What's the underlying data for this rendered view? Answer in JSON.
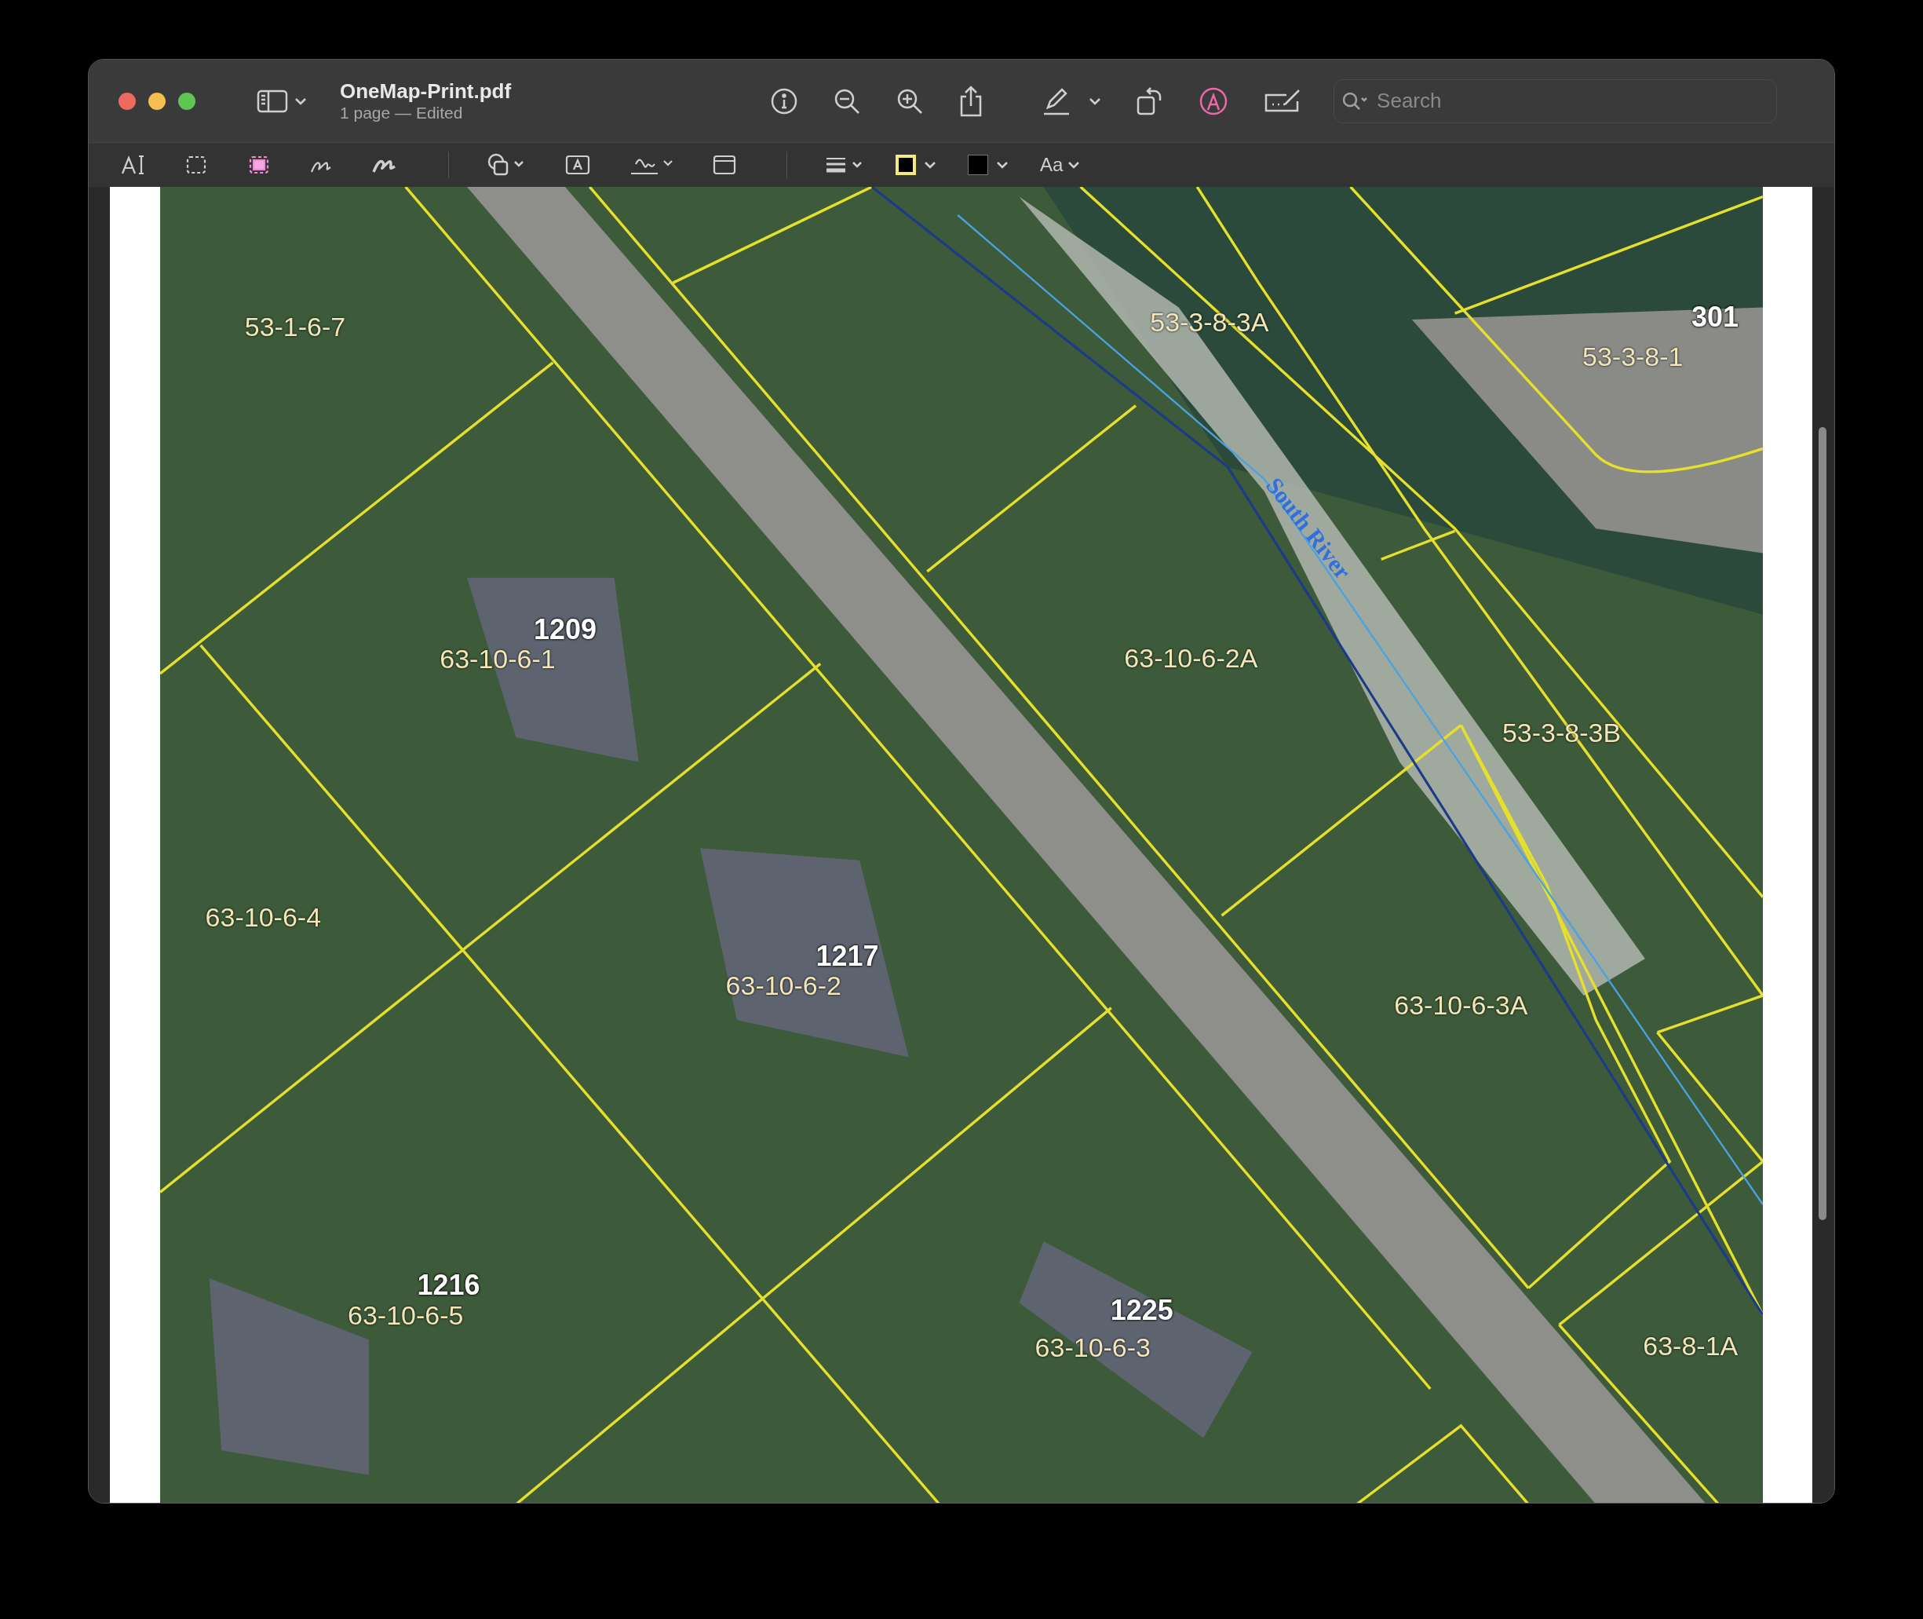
{
  "window": {
    "title": "OneMap-Print.pdf",
    "subtitle": "1 page — Edited"
  },
  "search": {
    "placeholder": "Search"
  },
  "markup_tools": [
    {
      "kind": "text",
      "selected": false
    },
    {
      "kind": "rect-select",
      "selected": false
    },
    {
      "kind": "smart-select",
      "selected": true
    },
    {
      "kind": "sketch",
      "selected": false
    },
    {
      "kind": "draw",
      "selected": false
    }
  ],
  "swatches": [
    {
      "kind": "border",
      "color": "#f2ea7a"
    },
    {
      "kind": "fill",
      "color": "#000000"
    }
  ],
  "font_button": "Aa",
  "map": {
    "river_label": "South River",
    "labels": [
      {
        "kind": "parcel",
        "text": "53-1-6-7"
      },
      {
        "kind": "parcel",
        "text": "53-3-8-3A"
      },
      {
        "kind": "address",
        "text": "301"
      },
      {
        "kind": "parcel",
        "text": "53-3-8-1"
      },
      {
        "kind": "address",
        "text": "1209"
      },
      {
        "kind": "parcel",
        "text": "63-10-6-1"
      },
      {
        "kind": "parcel",
        "text": "63-10-6-2A"
      },
      {
        "kind": "parcel",
        "text": "53-3-8-3B"
      },
      {
        "kind": "parcel",
        "text": "63-10-6-4"
      },
      {
        "kind": "address",
        "text": "1217"
      },
      {
        "kind": "parcel",
        "text": "63-10-6-2"
      },
      {
        "kind": "parcel",
        "text": "63-10-6-3A"
      },
      {
        "kind": "address",
        "text": "1216"
      },
      {
        "kind": "parcel",
        "text": "63-10-6-5"
      },
      {
        "kind": "address",
        "text": "1225"
      },
      {
        "kind": "parcel",
        "text": "63-10-6-3"
      },
      {
        "kind": "parcel",
        "text": "63-8-1A"
      }
    ]
  }
}
